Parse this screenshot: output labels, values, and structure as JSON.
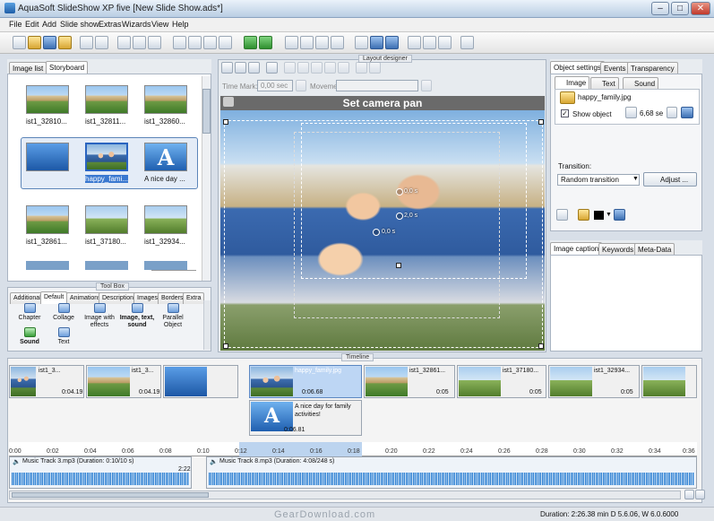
{
  "window": {
    "title": "AquaSoft SlideShow XP five  [New Slide Show.ads*]"
  },
  "menu": [
    "File",
    "Edit",
    "Add",
    "Slide show",
    "Extras",
    "Wizards",
    "View",
    "Help"
  ],
  "left_panel": {
    "tabs": [
      "Image list",
      "Storyboard"
    ],
    "storyboard": [
      {
        "label": "ist1_32810..."
      },
      {
        "label": "ist1_32811..."
      },
      {
        "label": "ist1_32860..."
      },
      {
        "label": "happy_fami..."
      },
      {
        "label": "A nice day ..."
      },
      {
        "label": "ist1_32861..."
      },
      {
        "label": "ist1_37180..."
      },
      {
        "label": "ist1_32934..."
      }
    ]
  },
  "toolbox": {
    "legend": "Tool Box",
    "tabs": [
      "Additional",
      "Default",
      "Animations",
      "Descriptions",
      "Images",
      "Borders",
      "Extra"
    ],
    "tools": [
      "Chapter",
      "Collage",
      "Image with effects",
      "Image, text, sound",
      "Parallel Object",
      "Sound",
      "Text"
    ]
  },
  "layout_designer": {
    "legend": "Layout designer",
    "time_mark_label": "Time Mark:",
    "time_mark_value": "0,00 sec",
    "movement_label": "Movement:",
    "caption": "Set camera pan",
    "markers": [
      "0,0 s",
      "2,0 s",
      "0,0 s"
    ]
  },
  "object_settings": {
    "tabs": [
      "Object settings",
      "Events",
      "Transparency"
    ],
    "subtabs": [
      "Image",
      "Text",
      "Sound"
    ],
    "filename": "happy_family.jpg",
    "show_object_label": "Show object",
    "duration": "6,68 se",
    "transition_label": "Transition:",
    "transition_value": "Random transition",
    "adjust_button": "Adjust ..."
  },
  "caption_panel": {
    "tabs": [
      "Image caption",
      "Keywords",
      "Meta-Data"
    ]
  },
  "timeline": {
    "legend": "Timeline",
    "clips": [
      {
        "name": "ist1_3...",
        "duration": "0:04.19"
      },
      {
        "name": "ist1_3...",
        "duration": "0:04.19"
      },
      {
        "name": "happy_family.jpg",
        "duration": "0:06.68"
      },
      {
        "name": "ist1_32861...",
        "duration": "0:05"
      },
      {
        "name": "ist1_37180...",
        "duration": "0:05"
      },
      {
        "name": "ist1_32934...",
        "duration": "0:05"
      }
    ],
    "text_clip": {
      "name": "A nice day for family activities!",
      "duration": "0:06.81"
    },
    "ruler": [
      "0:00",
      "0:02",
      "0:04",
      "0:06",
      "0:08",
      "0:10",
      "0:12",
      "0:14",
      "0:16",
      "0:18",
      "0:20",
      "0:22",
      "0:24",
      "0:26",
      "0:28",
      "0:30",
      "0:32",
      "0:34",
      "0:36"
    ],
    "audio": [
      {
        "label": "Music Track 3.mp3 (Duration: 0:10/10 s)",
        "marker": "2:22"
      },
      {
        "label": "Music Track 8.mp3 (Duration: 4:08/248 s)"
      }
    ]
  },
  "status": {
    "text": "Duration: 2:26.38 min  D 5.6.06, W 6.0.6000"
  },
  "watermark": "GearDownload.com"
}
